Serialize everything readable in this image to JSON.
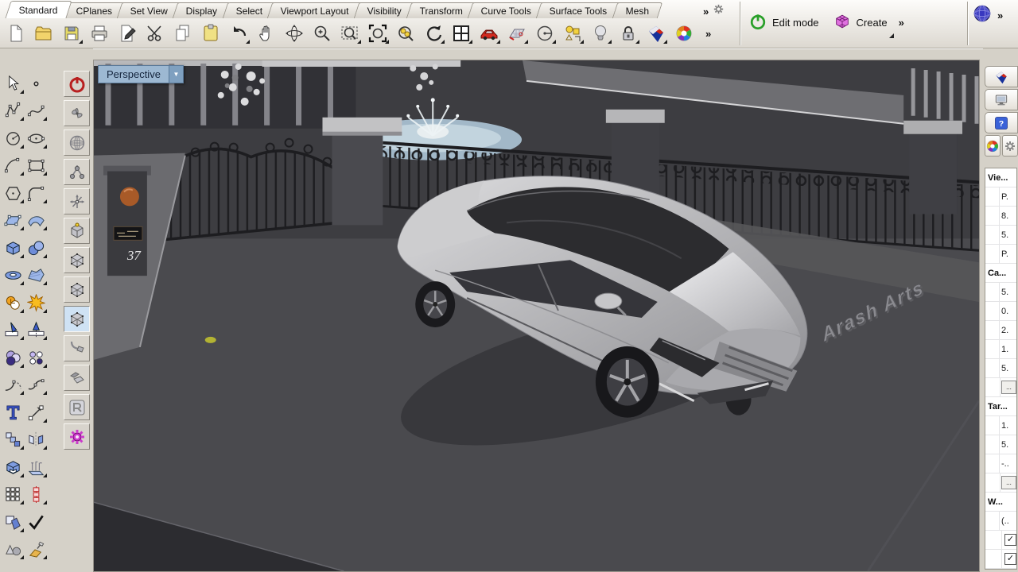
{
  "tab_bar": {
    "tabs": [
      {
        "label": "Standard",
        "active": true
      },
      {
        "label": "CPlanes"
      },
      {
        "label": "Set View"
      },
      {
        "label": "Display"
      },
      {
        "label": "Select"
      },
      {
        "label": "Viewport Layout"
      },
      {
        "label": "Visibility"
      },
      {
        "label": "Transform"
      },
      {
        "label": "Curve Tools"
      },
      {
        "label": "Surface Tools"
      },
      {
        "label": "Mesh"
      }
    ],
    "overflow": "»"
  },
  "main_toolbar": {
    "overflow": "»",
    "icons": [
      {
        "name": "new-file-icon",
        "kind": "doc",
        "flyout": false
      },
      {
        "name": "open-file-icon",
        "kind": "folder",
        "flyout": false
      },
      {
        "name": "save-icon",
        "kind": "floppy",
        "flyout": true
      },
      {
        "name": "print-icon",
        "kind": "printer",
        "flyout": false
      },
      {
        "name": "export-annotate-icon",
        "kind": "docpen",
        "flyout": false
      },
      {
        "name": "cut-icon",
        "kind": "scissors",
        "flyout": false
      },
      {
        "name": "copy-icon",
        "kind": "copy",
        "flyout": false
      },
      {
        "name": "paste-icon",
        "kind": "clipboard",
        "flyout": false
      },
      {
        "name": "undo-icon",
        "kind": "undo",
        "flyout": true
      },
      {
        "name": "pan-icon",
        "kind": "hand",
        "flyout": false
      },
      {
        "name": "rotate-view-icon",
        "kind": "orbit",
        "flyout": false
      },
      {
        "name": "zoom-dynamic-icon",
        "kind": "zoomplus",
        "flyout": false
      },
      {
        "name": "zoom-window-icon",
        "kind": "zoomwin",
        "flyout": true
      },
      {
        "name": "zoom-extents-icon",
        "kind": "zoomext",
        "flyout": true
      },
      {
        "name": "zoom-selected-icon",
        "kind": "zoomsel",
        "flyout": false
      },
      {
        "name": "undo-view-change-icon",
        "kind": "undoview",
        "flyout": true
      },
      {
        "name": "viewport-layout-icon",
        "kind": "grid4",
        "flyout": true
      },
      {
        "name": "named-view-car-icon",
        "kind": "car",
        "flyout": true
      },
      {
        "name": "cplane-icon",
        "kind": "cplane",
        "flyout": true
      },
      {
        "name": "radius-circle-icon",
        "kind": "circleray",
        "flyout": true
      },
      {
        "name": "select-objects-icon",
        "kind": "selobjs",
        "flyout": true
      },
      {
        "name": "lights-icon",
        "kind": "bulb",
        "flyout": true
      },
      {
        "name": "lock-icon",
        "kind": "lock",
        "flyout": true
      },
      {
        "name": "display-mode-icon",
        "kind": "shield",
        "flyout": true
      },
      {
        "name": "color-wheel-icon",
        "kind": "colorwheel",
        "flyout": false
      }
    ]
  },
  "mode_toolbar": {
    "edit_mode_label": "Edit mode",
    "create_label": "Create",
    "overflow": "»"
  },
  "sphere_toolbar": {
    "overflow": "»"
  },
  "left_toolbar_main": {
    "icons": [
      {
        "name": "pointer-icon",
        "kind": "cursor",
        "flyout": true
      },
      {
        "name": "point-icon",
        "kind": "point",
        "flyout": false
      },
      {
        "name": "polyline-icon",
        "kind": "polyline",
        "flyout": true
      },
      {
        "name": "curve-icon",
        "kind": "curve",
        "flyout": true
      },
      {
        "name": "circle-icon",
        "kind": "circle2",
        "flyout": true
      },
      {
        "name": "ellipse-icon",
        "kind": "ellipse",
        "flyout": true
      },
      {
        "name": "arc-icon",
        "kind": "arc",
        "flyout": true
      },
      {
        "name": "rectangle-icon",
        "kind": "rect2",
        "flyout": true
      },
      {
        "name": "polygon-icon",
        "kind": "polygon",
        "flyout": true
      },
      {
        "name": "freeform-curve-icon",
        "kind": "fillet",
        "flyout": true
      },
      {
        "name": "surface-plane-icon",
        "kind": "srfA",
        "flyout": true
      },
      {
        "name": "surface-bend-icon",
        "kind": "srfB",
        "flyout": true
      },
      {
        "name": "box-icon",
        "kind": "box",
        "flyout": true
      },
      {
        "name": "sphere-icon",
        "kind": "spheres",
        "flyout": true
      },
      {
        "name": "torus-icon",
        "kind": "torus",
        "flyout": true
      },
      {
        "name": "patch-icon",
        "kind": "patch",
        "flyout": true
      },
      {
        "name": "boolean-union-icon",
        "kind": "union",
        "flyout": true
      },
      {
        "name": "explode-icon",
        "kind": "explode",
        "flyout": true
      },
      {
        "name": "trim-icon",
        "kind": "trim",
        "flyout": true
      },
      {
        "name": "split-icon",
        "kind": "split",
        "flyout": true
      },
      {
        "name": "boolean-intersect-icon",
        "kind": "venn",
        "flyout": true
      },
      {
        "name": "point-cloud-icon",
        "kind": "dots",
        "flyout": true
      },
      {
        "name": "blend-curve-icon",
        "kind": "arcs",
        "flyout": true
      },
      {
        "name": "extend-curve-icon",
        "kind": "arcs2",
        "flyout": true
      },
      {
        "name": "text-icon",
        "kind": "textT",
        "flyout": false
      },
      {
        "name": "move-icon",
        "kind": "move",
        "flyout": true
      },
      {
        "name": "copy-objects-icon",
        "kind": "copy2",
        "flyout": true
      },
      {
        "name": "mirror-icon",
        "kind": "mirror",
        "flyout": true
      },
      {
        "name": "cap-solid-icon",
        "kind": "solid",
        "flyout": true
      },
      {
        "name": "extrude-icon",
        "kind": "extrude",
        "flyout": true
      },
      {
        "name": "array-grid-icon",
        "kind": "grid9",
        "flyout": true
      },
      {
        "name": "array-linear-icon",
        "kind": "arrayred",
        "flyout": true
      },
      {
        "name": "boolean-difference-icon",
        "kind": "booldiff",
        "flyout": true
      },
      {
        "name": "check-icon",
        "kind": "check",
        "flyout": false
      },
      {
        "name": "primitives-icon",
        "kind": "cones",
        "flyout": true
      },
      {
        "name": "render-lamp-icon",
        "kind": "lamp",
        "flyout": true
      }
    ]
  },
  "left_toolbar_side": {
    "icons": [
      {
        "name": "record-history-icon",
        "kind": "powerR",
        "selected": false
      },
      {
        "name": "manipulator-fan-icon",
        "kind": "fan",
        "selected": false
      },
      {
        "name": "gumball-globe-icon",
        "kind": "globewire",
        "selected": false
      },
      {
        "name": "constraint-joint-icon",
        "kind": "joint",
        "selected": false
      },
      {
        "name": "move-axes-icon",
        "kind": "axes",
        "selected": false
      },
      {
        "name": "cube-corner-point-icon",
        "kind": "cubedot",
        "selected": false
      },
      {
        "name": "wire-cube-a-icon",
        "kind": "wirecube",
        "selected": false
      },
      {
        "name": "wire-cube-b-icon",
        "kind": "wirecube",
        "selected": false
      },
      {
        "name": "wire-cube-selected-icon",
        "kind": "wirecube",
        "selected": true
      },
      {
        "name": "bend-tool-icon",
        "kind": "bend",
        "selected": false
      },
      {
        "name": "orient-tool-icon",
        "kind": "flatten",
        "selected": false
      },
      {
        "name": "hotkey-r-icon",
        "kind": "keyR",
        "selected": false
      },
      {
        "name": "options-gear-icon",
        "kind": "gearM",
        "selected": false
      }
    ]
  },
  "viewport": {
    "title": "Perspective",
    "dropdown": "▼"
  },
  "scene": {
    "watermark": "Arash Arts",
    "house_number": "37",
    "road_color": "#4a4a4e",
    "yard_color": "#3d3d41",
    "sidewalk_color": "#6b6b6f",
    "pool_color": "#a2b8c8",
    "fence_color": "#1d1d20",
    "car_body_color": "#c0c0c3"
  },
  "right_panel": {
    "check_glyph": "✓",
    "ellipsis_glyph": "...",
    "tabs": [
      {
        "name": "display-mode-tab-icon",
        "kind": "shield",
        "half": false
      },
      {
        "name": "viewport-properties-tab-icon",
        "kind": "monitor",
        "half": false
      },
      {
        "name": "help-tab-icon",
        "kind": "help",
        "half": false
      },
      {
        "name": "color-tab-icon",
        "kind": "colorwheel",
        "half": true
      },
      {
        "name": "settings-tab-icon",
        "kind": "gear",
        "half": true
      }
    ],
    "sections": [
      {
        "header": "Vie...",
        "rows": [
          {
            "value": "P."
          },
          {
            "value": "8."
          },
          {
            "value": "5."
          },
          {
            "value": "P."
          }
        ]
      },
      {
        "header": "Ca...",
        "rows": [
          {
            "value": "5."
          },
          {
            "value": "0."
          },
          {
            "value": "2."
          },
          {
            "value": "1."
          },
          {
            "value": "5."
          },
          {
            "value": "...",
            "button": true
          }
        ]
      },
      {
        "header": "Tar...",
        "rows": [
          {
            "value": "1."
          },
          {
            "value": "5."
          },
          {
            "value": "-.."
          },
          {
            "value": "...",
            "button": true
          }
        ]
      },
      {
        "header": "W...",
        "rows": [
          {
            "value": "(.."
          },
          {
            "checkbox": true,
            "checked": true
          },
          {
            "checkbox": true,
            "checked": true
          }
        ]
      }
    ]
  }
}
